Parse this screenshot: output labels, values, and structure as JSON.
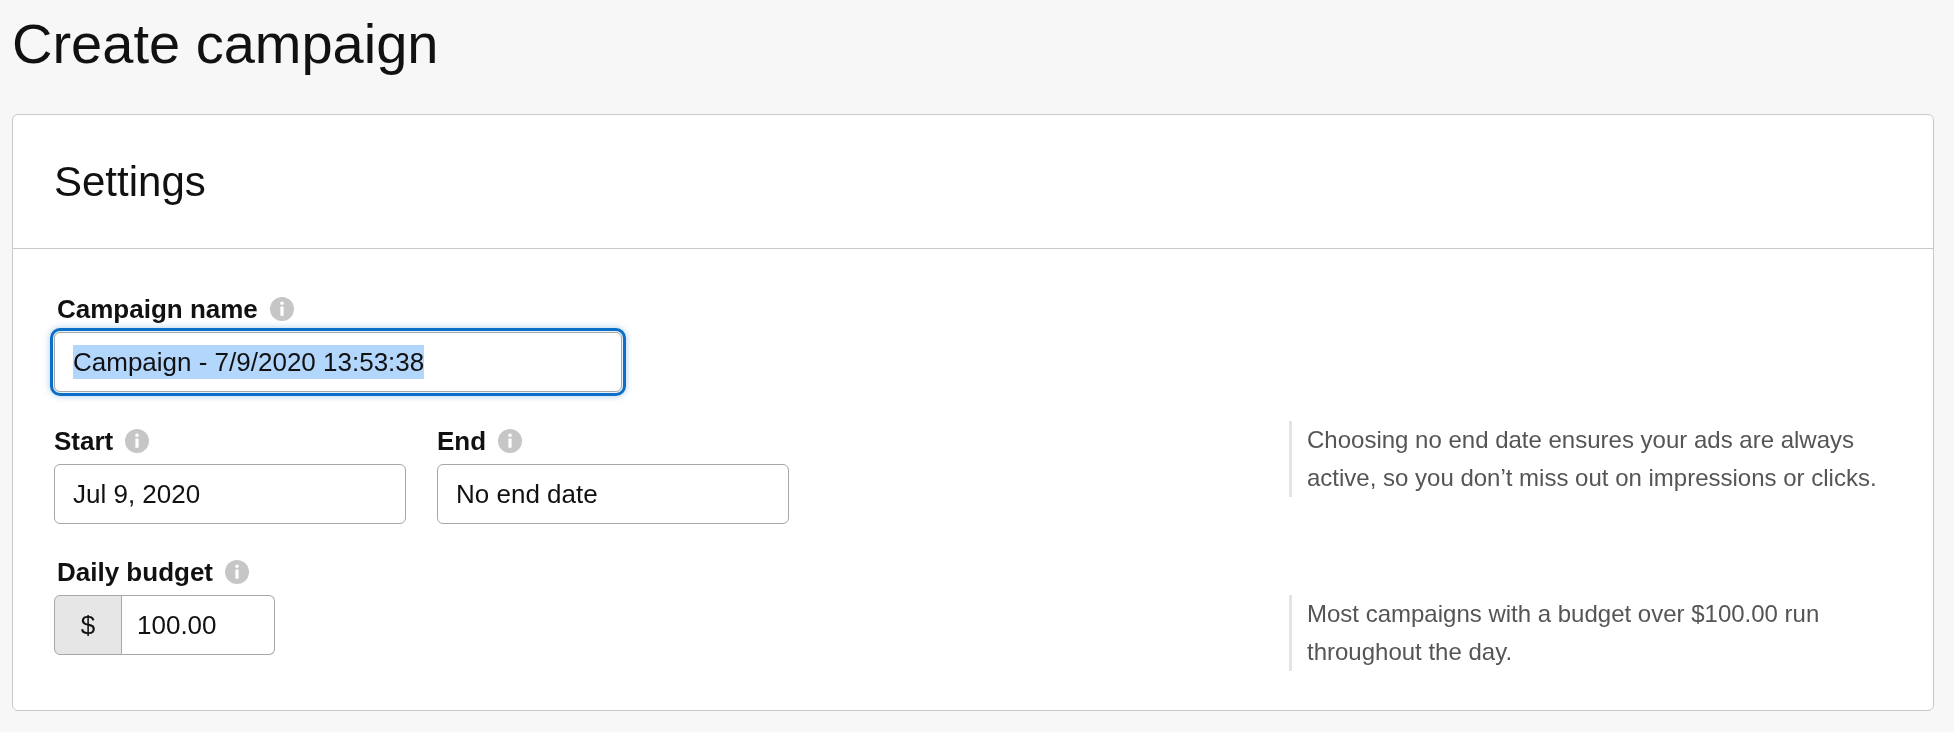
{
  "page_title": "Create campaign",
  "settings": {
    "title": "Settings",
    "rows": [
      {
        "fields": [
          {
            "kind": "text",
            "label": "Campaign name",
            "value": "Campaign - 7/9/2020 13:53:38",
            "focused": true,
            "text_selected": true
          }
        ]
      },
      {
        "fields": [
          {
            "kind": "date",
            "label": "Start",
            "value": "Jul 9, 2020",
            "focused": false,
            "text_selected": false
          },
          {
            "kind": "date",
            "label": "End",
            "value": "No end date",
            "focused": false,
            "text_selected": false
          }
        ],
        "hint": "Choosing no end date ensures your ads are always active, so you don’t miss out on impressions or clicks."
      },
      {
        "fields": [
          {
            "kind": "currency",
            "label": "Daily budget",
            "currency": "$",
            "value": "100.00",
            "focused": false,
            "text_selected": false
          }
        ],
        "hint": "Most campaigns with a budget over $100.00 run throughout the day."
      }
    ]
  }
}
